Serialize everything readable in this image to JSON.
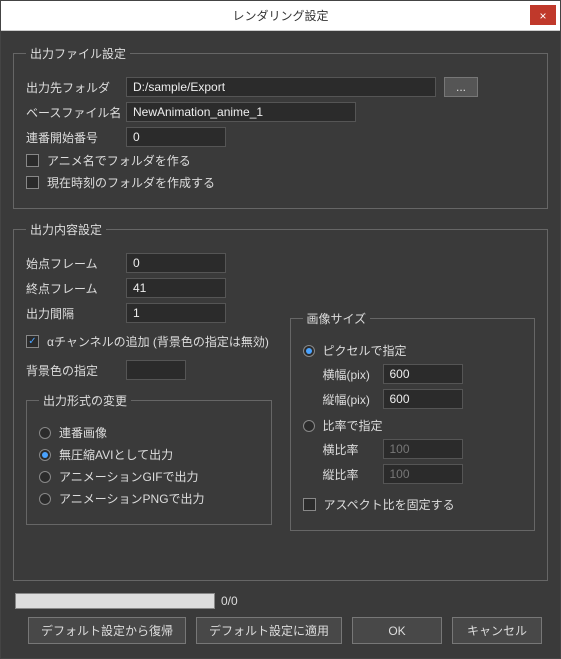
{
  "title": "レンダリング設定",
  "close": "×",
  "fileSettings": {
    "legend": "出力ファイル設定",
    "outputFolderLabel": "出力先フォルダ",
    "outputFolderValue": "D:/sample/Export",
    "browse": "...",
    "baseFileNameLabel": "ベースファイル名",
    "baseFileNameValue": "NewAnimation_anime_1",
    "seqStartLabel": "連番開始番号",
    "seqStartValue": "0",
    "makeFolderByAnimeLabel": "アニメ名でフォルダを作る",
    "makeFolderByAnimeChecked": false,
    "makeTimestampFolderLabel": "現在時刻のフォルダを作成する",
    "makeTimestampFolderChecked": false
  },
  "outputSettings": {
    "legend": "出力内容設定",
    "startFrameLabel": "始点フレーム",
    "startFrameValue": "0",
    "endFrameLabel": "終点フレーム",
    "endFrameValue": "41",
    "intervalLabel": "出力間隔",
    "intervalValue": "1",
    "alphaLabel": "αチャンネルの追加 (背景色の指定は無効)",
    "alphaChecked": true,
    "bgColorLabel": "背景色の指定",
    "formatLegend": "出力形式の変更",
    "formatOptions": {
      "seqImages": "連番画像",
      "aviUncompressed": "無圧縮AVIとして出力",
      "gifAnim": "アニメーションGIFで出力",
      "pngAnim": "アニメーションPNGで出力"
    },
    "formatSelected": "aviUncompressed",
    "imageSize": {
      "legend": "画像サイズ",
      "modePixelLabel": "ピクセルで指定",
      "modeRatioLabel": "比率で指定",
      "modeSelected": "pixel",
      "widthPxLabel": "横幅(pix)",
      "widthPxValue": "600",
      "heightPxLabel": "縦幅(pix)",
      "heightPxValue": "600",
      "widthRatioLabel": "横比率",
      "widthRatioValue": "100",
      "heightRatioLabel": "縦比率",
      "heightRatioValue": "100",
      "lockAspectLabel": "アスペクト比を固定する",
      "lockAspectChecked": false
    }
  },
  "progressText": "0/0",
  "buttons": {
    "restoreDefault": "デフォルト設定から復帰",
    "applyDefault": "デフォルト設定に適用",
    "ok": "OK",
    "cancel": "キャンセル"
  }
}
